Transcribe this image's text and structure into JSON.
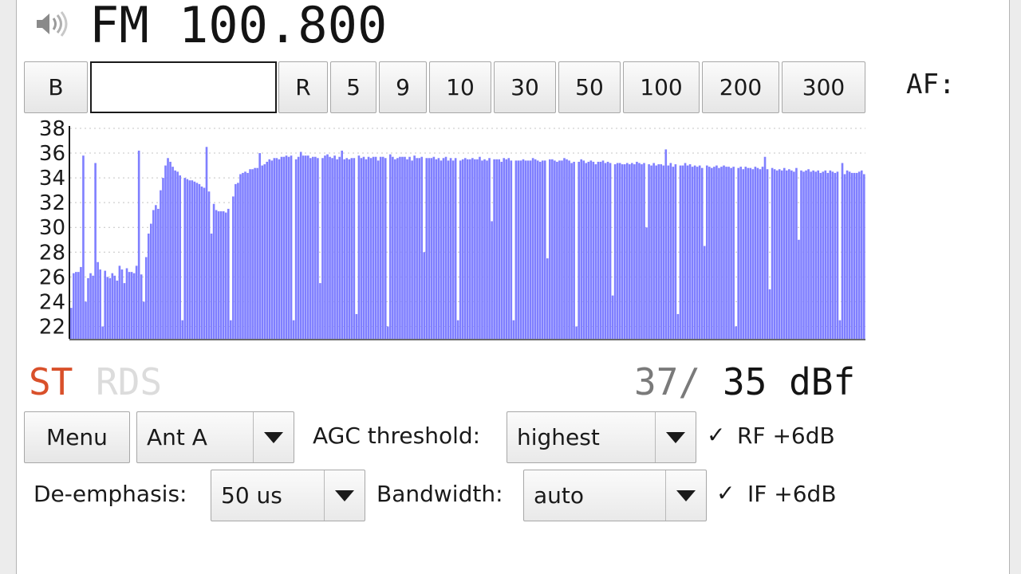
{
  "header": {
    "frequency": "FM 100.800",
    "speaker_icon": "speaker-icon"
  },
  "step_bar": {
    "band_button": "B",
    "step_input_value": "",
    "reset_button": "R",
    "steps": [
      "5",
      "9",
      "10",
      "30",
      "50",
      "100",
      "200",
      "300"
    ],
    "af_label": "AF:"
  },
  "chart_data": {
    "type": "bar",
    "ylim": [
      21,
      38
    ],
    "yticks": [
      "38",
      "36",
      "34",
      "32",
      "30",
      "28",
      "26",
      "24",
      "22"
    ],
    "bar_color": "#7f7fff",
    "grid": true,
    "values": [
      25.9,
      26.3,
      26.4,
      26.4,
      26.8,
      26.7,
      26.3,
      25.9,
      26.3,
      26.1,
      26.3,
      27.2,
      26.6,
      25.9,
      26.5,
      26.0,
      25.9,
      26.3,
      26.1,
      25.7,
      26.9,
      26.6,
      26.5,
      26.7,
      26.4,
      26.4,
      26.3,
      26.9,
      26.4,
      26.2,
      26.2,
      27.6,
      29.5,
      30.3,
      31.4,
      31.8,
      31.5,
      33.0,
      34.0,
      35.0,
      35.6,
      35.3,
      34.9,
      34.6,
      34.5,
      34.2,
      34.1,
      34.0,
      33.9,
      33.8,
      33.8,
      33.7,
      33.6,
      33.5,
      33.3,
      33.2,
      33.0,
      32.9,
      32.4,
      31.9,
      31.4,
      31.3,
      31.3,
      31.3,
      31.2,
      31.5,
      31.7,
      32.5,
      33.5,
      33.6,
      34.3,
      34.4,
      34.5,
      34.4,
      34.7,
      34.7,
      34.8,
      34.8,
      35.2,
      35.0,
      35.1,
      35.3,
      35.5,
      35.4,
      35.6,
      35.6,
      35.5,
      35.7,
      35.7,
      35.8,
      35.7,
      35.8,
      35.6,
      35.5,
      35.7,
      35.8,
      35.8,
      35.8,
      35.8,
      35.6,
      35.7,
      35.7,
      35.6,
      35.7,
      35.6,
      35.8,
      35.9,
      35.7,
      35.6,
      35.8,
      35.5,
      35.7,
      35.6,
      35.5,
      35.6,
      35.5,
      35.6,
      35.6,
      35.6,
      35.8,
      35.6,
      35.7,
      35.5,
      35.7,
      35.6,
      35.7,
      35.7,
      35.4,
      35.7,
      35.7,
      35.6,
      35.6,
      35.8,
      35.7,
      35.5,
      35.6,
      35.7,
      35.7,
      35.7,
      35.5,
      35.7,
      35.4,
      35.8,
      35.6,
      35.6,
      35.7,
      35.5,
      35.6,
      35.6,
      35.6,
      35.7,
      35.5,
      35.6,
      35.4,
      35.6,
      35.7,
      35.4,
      35.6,
      35.4,
      35.6,
      35.5,
      35.4,
      35.5,
      35.6,
      35.5,
      35.5,
      35.6,
      35.5,
      35.5,
      35.7,
      35.4,
      35.5,
      35.4,
      35.6,
      35.6,
      35.5,
      35.5,
      35.5,
      35.3,
      35.6,
      35.5,
      35.6,
      35.4,
      35.6,
      35.4,
      35.5,
      35.4,
      35.5,
      35.4,
      35.4,
      35.4,
      35.6,
      35.5,
      35.4,
      35.3,
      35.4,
      35.4,
      35.4,
      35.5,
      35.5,
      35.4,
      35.3,
      35.4,
      35.4,
      35.6,
      35.5,
      35.4,
      35.2,
      35.3,
      35.4,
      35.3,
      35.2,
      35.4,
      35.2,
      35.3,
      35.4,
      35.3,
      35.1,
      35.3,
      35.3,
      35.4,
      35.2,
      35.3,
      35.2,
      35.4,
      35.1,
      35.2,
      35.2,
      35.1,
      35.1,
      35.2,
      35.1,
      35.2,
      35.1,
      35.3,
      35.2,
      35.1,
      35.2,
      35.0,
      35.1,
      35.0,
      35.2,
      35.0,
      35.1,
      35.1,
      35.0,
      35.1,
      35.0,
      35.2,
      34.9,
      35.1,
      35.0,
      35.0,
      35.0,
      35.2,
      35.0,
      35.1,
      34.9,
      35.0,
      34.9,
      35.0,
      34.8,
      35.0,
      35.0,
      34.9,
      34.8,
      34.9,
      35.0,
      34.8,
      34.9,
      35.0,
      34.9,
      34.9,
      34.8,
      34.9,
      34.8,
      34.8,
      34.9,
      34.7,
      34.9,
      34.8,
      34.8,
      34.7,
      34.9,
      34.8,
      34.7,
      34.9,
      34.8,
      34.7,
      34.8,
      34.8,
      34.7,
      34.6,
      34.7,
      34.6,
      34.8,
      34.6,
      34.7,
      34.6,
      34.5,
      34.8,
      34.6,
      34.6,
      34.5,
      34.6,
      34.7,
      34.5,
      34.6,
      34.5,
      34.6,
      34.4,
      34.5,
      34.6,
      34.4,
      34.6,
      34.5,
      34.4,
      34.5,
      34.6,
      34.5,
      34.3,
      34.6,
      34.5,
      34.4,
      34.4,
      34.4,
      34.5,
      34.6,
      34.3
    ],
    "dips": [
      [
        0,
        23.5
      ],
      [
        6,
        24.0
      ],
      [
        13,
        22.0
      ],
      [
        22,
        25.5
      ],
      [
        30,
        24.0
      ],
      [
        46,
        22.5
      ],
      [
        58,
        29.5
      ],
      [
        66,
        22.5
      ],
      [
        78,
        23.0
      ],
      [
        92,
        22.5
      ],
      [
        103,
        25.5
      ],
      [
        118,
        23.0
      ],
      [
        131,
        22.0
      ],
      [
        146,
        28.0
      ],
      [
        160,
        22.5
      ],
      [
        174,
        30.5
      ],
      [
        183,
        22.5
      ],
      [
        197,
        27.5
      ],
      [
        209,
        22.0
      ],
      [
        224,
        24.5
      ],
      [
        238,
        30.0
      ],
      [
        251,
        23.0
      ],
      [
        262,
        28.5
      ],
      [
        275,
        22.0
      ],
      [
        289,
        25.0
      ],
      [
        301,
        29.0
      ],
      [
        318,
        22.5
      ],
      [
        331,
        26.0
      ]
    ],
    "highlights": [
      [
        5,
        35.8
      ],
      [
        10,
        35.2
      ],
      [
        28,
        36.2
      ],
      [
        56,
        36.5
      ],
      [
        78,
        36.0
      ],
      [
        95,
        36.1
      ],
      [
        112,
        36.2
      ],
      [
        132,
        35.9
      ],
      [
        149,
        35.6
      ],
      [
        185,
        35.4
      ],
      [
        211,
        35.5
      ],
      [
        246,
        36.3
      ],
      [
        287,
        35.7
      ],
      [
        319,
        35.2
      ]
    ]
  },
  "indicators": {
    "stereo": "ST",
    "rds": "RDS",
    "signal_peak": "37/",
    "signal_current": "35 dBf"
  },
  "controls": {
    "menu_button": "Menu",
    "antenna": "Ant A",
    "agc_label": "AGC threshold:",
    "agc_value": "highest",
    "rf_label": "RF +6dB",
    "deemphasis_label": "De-emphasis:",
    "deemphasis_value": "50 us",
    "bandwidth_label": "Bandwidth:",
    "bandwidth_value": "auto",
    "if_label": "IF +6dB",
    "checkmark": "✓"
  }
}
